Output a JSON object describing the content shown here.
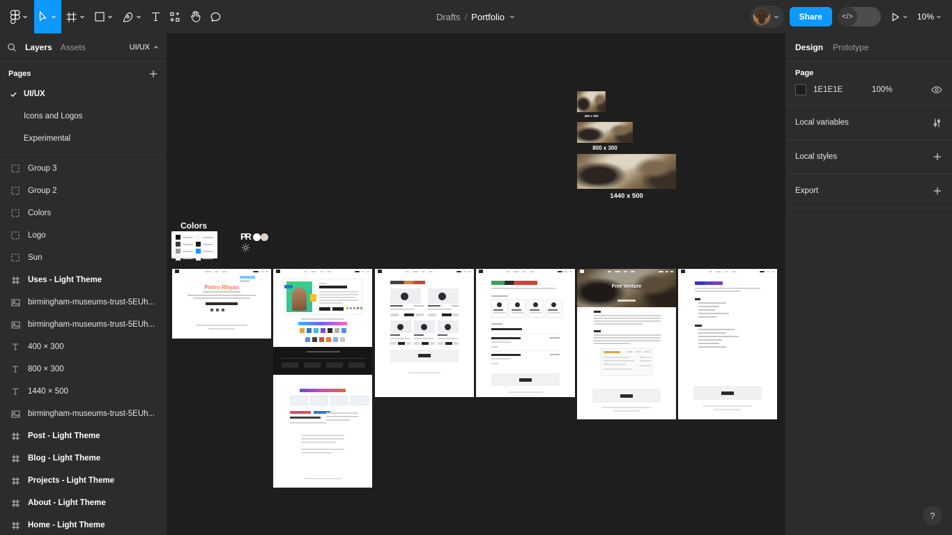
{
  "toolbar": {
    "tools": [
      {
        "name": "figma-logo-icon",
        "label": "Figma",
        "has_caret": true,
        "active": false
      },
      {
        "name": "move-tool-icon",
        "label": "Move",
        "has_caret": true,
        "active": true
      },
      {
        "name": "frame-tool-icon",
        "label": "Frame",
        "has_caret": true,
        "active": false
      },
      {
        "name": "shape-tool-icon",
        "label": "Rectangle",
        "has_caret": true,
        "active": false
      },
      {
        "name": "pen-tool-icon",
        "label": "Pen",
        "has_caret": true,
        "active": false
      },
      {
        "name": "text-tool-icon",
        "label": "Text",
        "has_caret": false,
        "active": false
      },
      {
        "name": "actions-tool-icon",
        "label": "Actions",
        "has_caret": false,
        "active": false
      },
      {
        "name": "hand-tool-icon",
        "label": "Hand",
        "has_caret": false,
        "active": false
      },
      {
        "name": "comment-tool-icon",
        "label": "Comment",
        "has_caret": false,
        "active": false
      }
    ],
    "breadcrumb": {
      "project": "Drafts",
      "separator": "/",
      "file": "Portfolio"
    },
    "share_label": "Share",
    "devmode_glyph": "</>",
    "zoom_level": "10%",
    "accent_color": "#0d99ff"
  },
  "left_panel": {
    "tabs": [
      {
        "label": "Layers",
        "active": true
      },
      {
        "label": "Assets",
        "active": false
      }
    ],
    "page_chip": "UI/UX",
    "pages_title": "Pages",
    "pages": [
      {
        "label": "UI/UX",
        "selected": true
      },
      {
        "label": "Icons and Logos",
        "selected": false
      },
      {
        "label": "Experimental",
        "selected": false
      }
    ],
    "layers": [
      {
        "label": "Group 3",
        "icon": "group-icon",
        "type": "group"
      },
      {
        "label": "Group 2",
        "icon": "group-icon",
        "type": "group"
      },
      {
        "label": "Colors",
        "icon": "group-icon",
        "type": "group"
      },
      {
        "label": "Logo",
        "icon": "group-icon",
        "type": "group"
      },
      {
        "label": "Sun",
        "icon": "group-icon",
        "type": "group"
      },
      {
        "label": "Uses - Light Theme",
        "icon": "frame-icon",
        "type": "frame"
      },
      {
        "label": "birmingham-museums-trust-5EUh...",
        "icon": "image-icon",
        "type": "image"
      },
      {
        "label": "birmingham-museums-trust-5EUh...",
        "icon": "image-icon",
        "type": "image"
      },
      {
        "label": "400 × 300",
        "icon": "text-icon",
        "type": "text"
      },
      {
        "label": "800 × 300",
        "icon": "text-icon",
        "type": "text"
      },
      {
        "label": "1440 × 500",
        "icon": "text-icon",
        "type": "text"
      },
      {
        "label": "birmingham-museums-trust-5EUh...",
        "icon": "image-icon",
        "type": "image"
      },
      {
        "label": "Post - Light Theme",
        "icon": "frame-icon",
        "type": "frame"
      },
      {
        "label": "Blog - Light Theme",
        "icon": "frame-icon",
        "type": "frame"
      },
      {
        "label": "Projects - Light Theme",
        "icon": "frame-icon",
        "type": "frame"
      },
      {
        "label": "About - Light Theme",
        "icon": "frame-icon",
        "type": "frame"
      },
      {
        "label": "Home - Light Theme",
        "icon": "frame-icon",
        "type": "frame"
      }
    ]
  },
  "canvas": {
    "colors_group_label": "Colors",
    "swatches": [
      {
        "hex": "#111111"
      },
      {
        "hex": "#3d3d3d"
      },
      {
        "hex": "#4a4a4a"
      },
      {
        "hex": "#1b1b1b"
      },
      {
        "hex": "#9a9a9a"
      },
      {
        "hex": "#0d99ff"
      },
      {
        "hex": "#f0f0f0"
      },
      {
        "hex": "#ffffff"
      }
    ],
    "logo_mark": "PR",
    "image_assets": [
      {
        "caption": "400 x 300"
      },
      {
        "caption": "800 x 300"
      },
      {
        "caption": "1440 x 500"
      }
    ],
    "frames": [
      {
        "label": "Home - Light Theme",
        "title": "Pietro Rhyan"
      },
      {
        "label": "About - Light Theme",
        "title": "Software Engineer."
      },
      {
        "label": "Projects - Light Theme",
        "title": "Works, Projects ... Hobby."
      },
      {
        "label": "Blog - Light Theme",
        "title": "How I Create, How I Think."
      },
      {
        "label": "Post - Light Theme",
        "title": "Free Venture"
      },
      {
        "label": "Uses - Light Theme",
        "title": "Setup, Tools, Apps."
      }
    ]
  },
  "right_panel": {
    "tabs": [
      {
        "label": "Design",
        "active": true
      },
      {
        "label": "Prototype",
        "active": false
      }
    ],
    "page_section_title": "Page",
    "page_color_hex": "1E1E1E",
    "page_color_opacity": "100%",
    "rows": [
      {
        "label": "Local variables",
        "icon": "sliders-icon"
      },
      {
        "label": "Local styles",
        "icon": "plus-icon"
      },
      {
        "label": "Export",
        "icon": "plus-icon"
      }
    ]
  },
  "help": {
    "glyph": "?",
    "name": "help-button"
  }
}
